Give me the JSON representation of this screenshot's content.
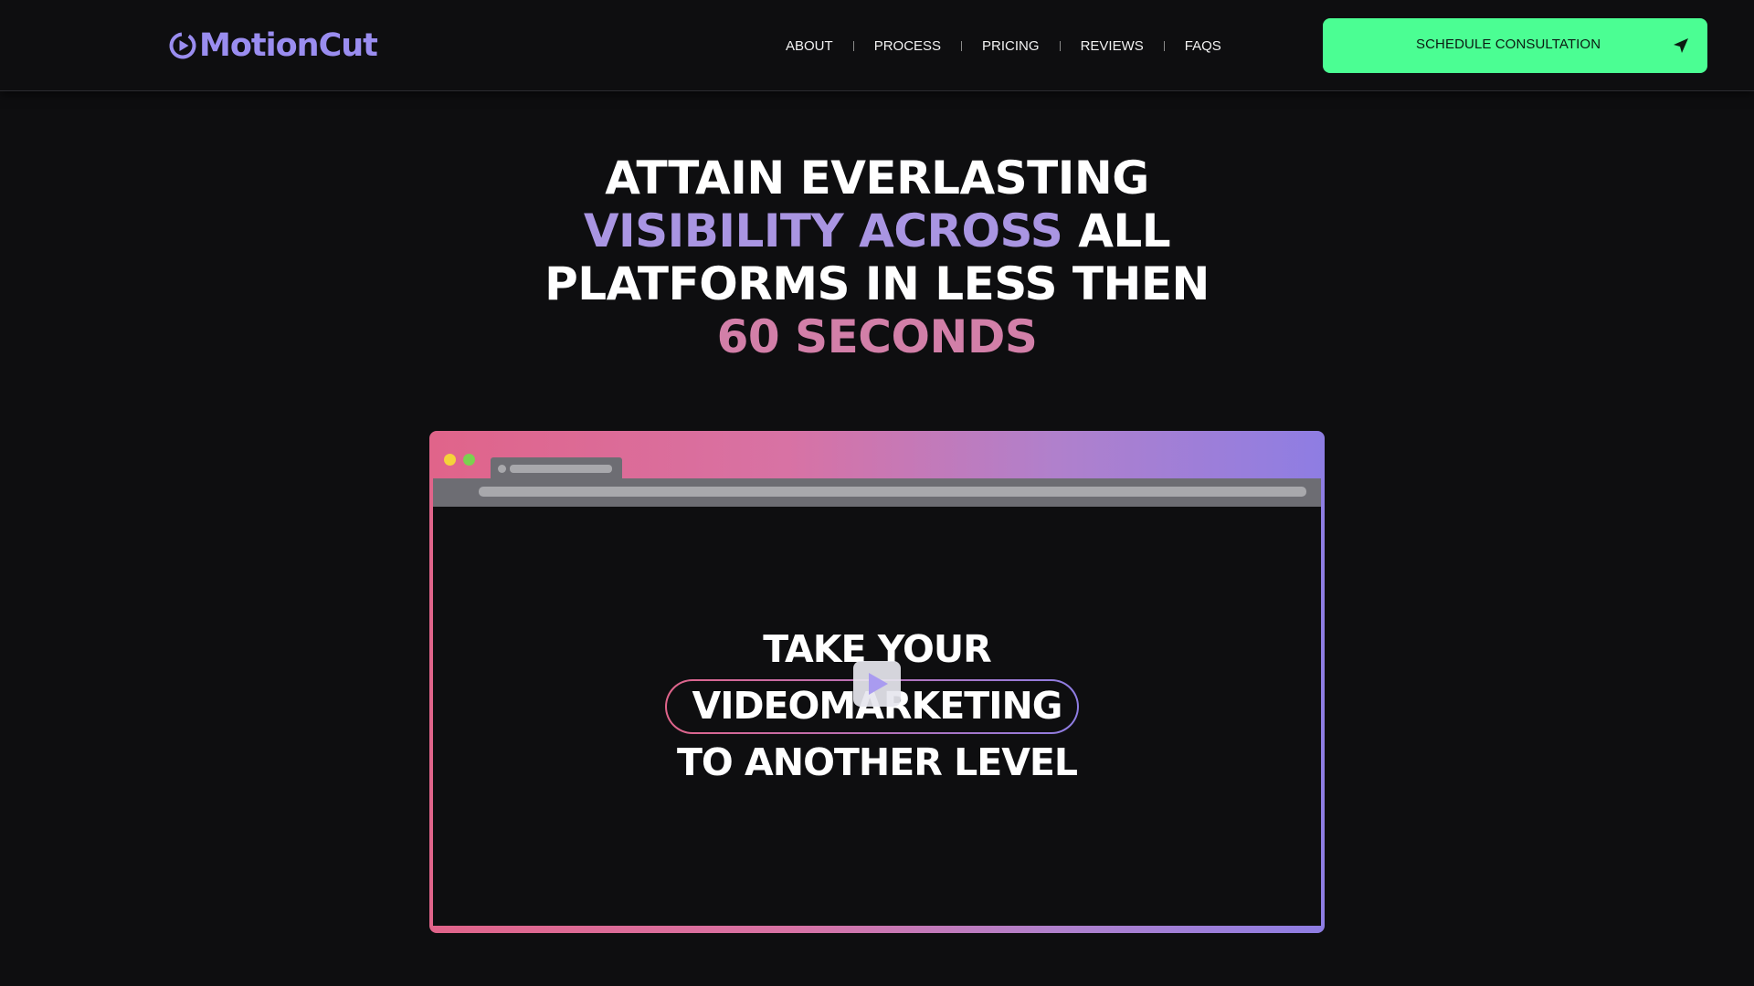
{
  "brand": {
    "name": "MotionCut",
    "color": "#9a8df0"
  },
  "nav": {
    "items": [
      {
        "label": "ABOUT"
      },
      {
        "label": "PROCESS"
      },
      {
        "label": "PRICING"
      },
      {
        "label": "REVIEWS"
      },
      {
        "label": "FAQS"
      }
    ]
  },
  "cta": {
    "label": "SCHEDULE CONSULTATION",
    "icon": "send-arrow-icon",
    "color": "#4bfe93"
  },
  "hero": {
    "line1": "ATTAIN EVERLASTING",
    "line2_highlight": "VISIBILITY ACROSS",
    "line2_rest": "ALL",
    "line3": "PLATFORMS IN LESS THEN",
    "line4_highlight": "60 SECONDS",
    "colors": {
      "violet": "#a995e2",
      "pink": "#d27fa8"
    }
  },
  "video": {
    "line1": "TAKE YOUR",
    "line2": "VIDEOMARKETING",
    "line3": "TO ANOTHER LEVEL",
    "play_icon": "play-icon",
    "frame_gradient": [
      "#e0648a",
      "#8e7de3"
    ]
  }
}
